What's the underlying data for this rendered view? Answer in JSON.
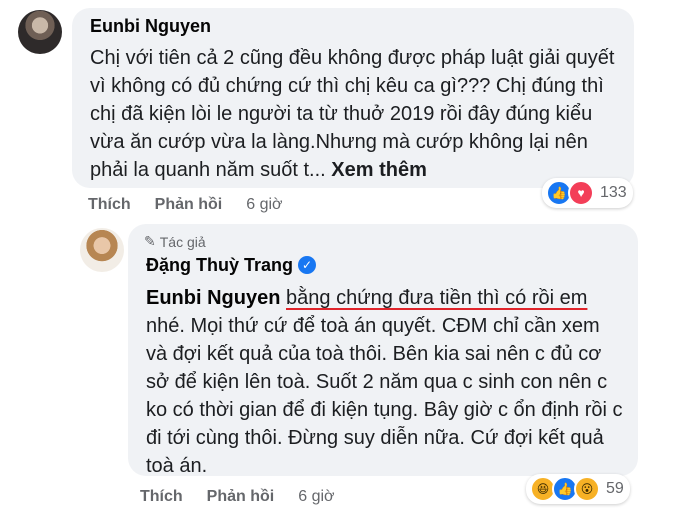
{
  "comment1": {
    "author": "Eunbi Nguyen",
    "text": "Chị với tiên cả 2 cũng đều không được pháp luật giải quyết vì không có đủ chứng cứ thì chị kêu ca gì??? Chị đúng thì chị đã kiện lòi le người ta từ thuở 2019 rồi đây đúng kiểu vừa ăn cướp vừa la làng.Nhưng mà cướp không lại nên phải la quanh năm suốt t...",
    "see_more": "Xem thêm",
    "actions": {
      "like": "Thích",
      "reply": "Phản hồi",
      "time": "6 giờ"
    },
    "reactions": {
      "count": "133",
      "icons": [
        "like-icon",
        "love-icon"
      ]
    }
  },
  "comment2": {
    "author_badge": "Tác giả",
    "author": "Đặng Thuỳ Trang",
    "mention": "Eunbi Nguyen",
    "underlined": "bằng chứng đưa tiền thì có rồi em",
    "text": "nhé. Mọi thứ cứ để toà án quyết. CĐM chỉ cần xem và đợi kết quả của toà thôi. Bên kia sai nên c đủ cơ sở để kiện lên toà. Suốt 2 năm qua c sinh con nên c ko có thời gian để đi kiện tụng. Bây giờ c ổn định rồi c đi tới cùng thôi. Đừng suy diễn nữa. Cứ đợi kết quả toà án.",
    "actions": {
      "like": "Thích",
      "reply": "Phản hồi",
      "time": "6 giờ"
    },
    "reactions": {
      "count": "59",
      "icons": [
        "haha-icon",
        "like-icon",
        "wow-icon"
      ]
    }
  }
}
